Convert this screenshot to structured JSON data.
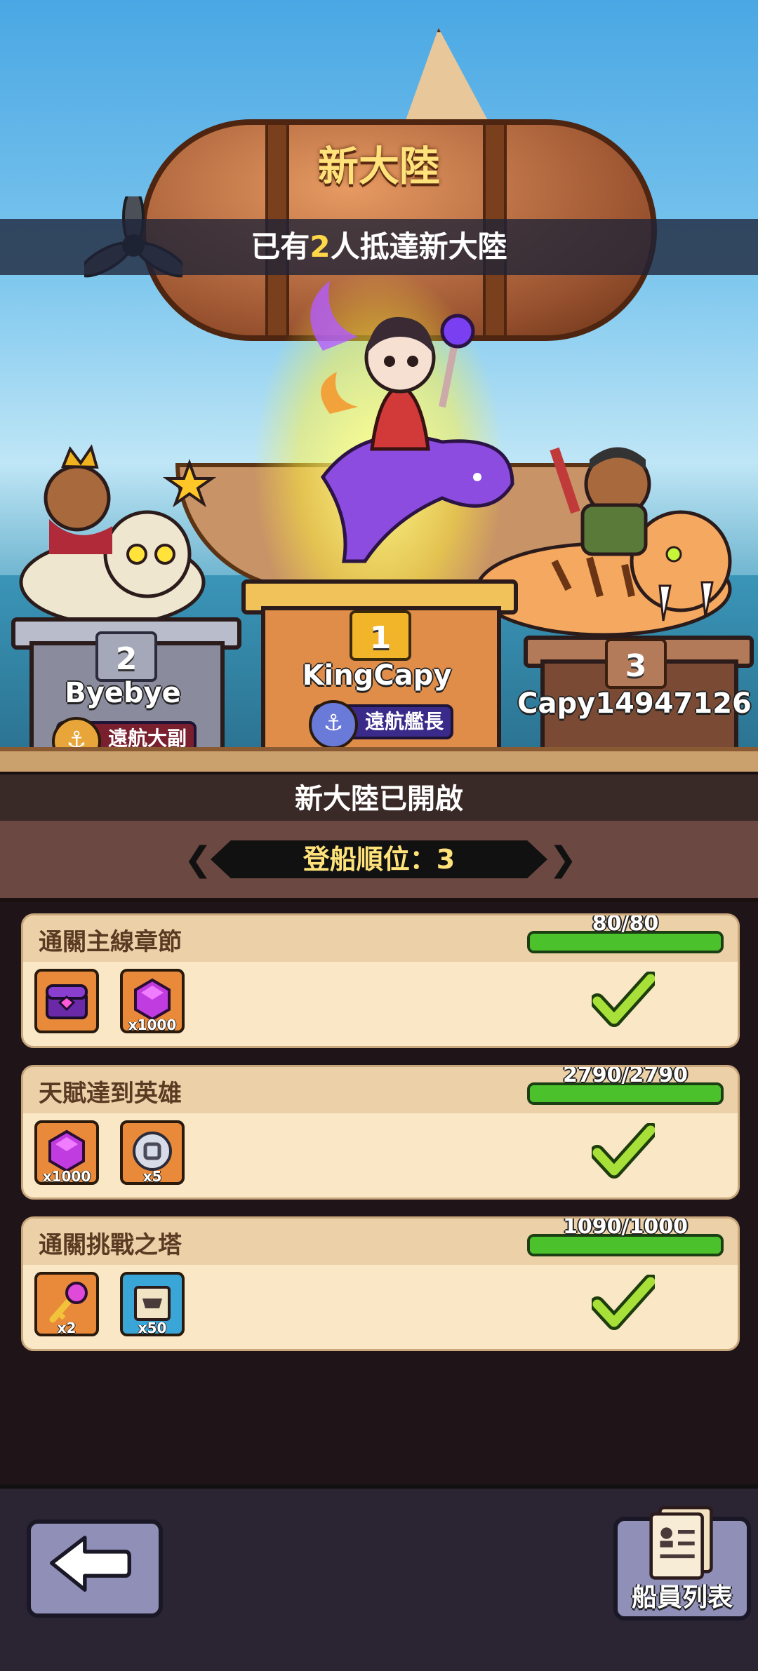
{
  "header": {
    "title": "新大陸",
    "arrived_prefix": "已有",
    "arrived_count": "2",
    "arrived_suffix": "人抵達新大陸"
  },
  "podium": [
    {
      "rank": "1",
      "name": "KingCapy",
      "title": "遠航艦長",
      "color": "#e8a25c"
    },
    {
      "rank": "2",
      "name": "Byebye",
      "title": "遠航大副",
      "color": "#7f7f8f"
    },
    {
      "rank": "3",
      "name": "Capy14947126",
      "title": "",
      "color": "#8a5a3c"
    }
  ],
  "status": {
    "opened": "新大陸已開啟",
    "boarding_rank": "登船順位：3"
  },
  "tasks": [
    {
      "title": "通關主線章節",
      "progress": "80/80",
      "fill": 1.0,
      "rewards": [
        {
          "icon": "purple-chest-icon",
          "qty": ""
        },
        {
          "icon": "purple-gem-icon",
          "qty": "x1000"
        }
      ]
    },
    {
      "title": "天賦達到英雄",
      "progress": "2790/2790",
      "fill": 1.0,
      "rewards": [
        {
          "icon": "purple-gem-icon",
          "qty": "x1000"
        },
        {
          "icon": "silver-coin-icon",
          "qty": "x5"
        }
      ]
    },
    {
      "title": "通關挑戰之塔",
      "progress": "1090/1000",
      "fill": 1.0,
      "rewards": [
        {
          "icon": "pink-key-icon",
          "qty": "x2"
        },
        {
          "icon": "blue-scroll-icon",
          "qty": "x50"
        }
      ]
    }
  ],
  "footer": {
    "crew_list": "船員列表"
  }
}
